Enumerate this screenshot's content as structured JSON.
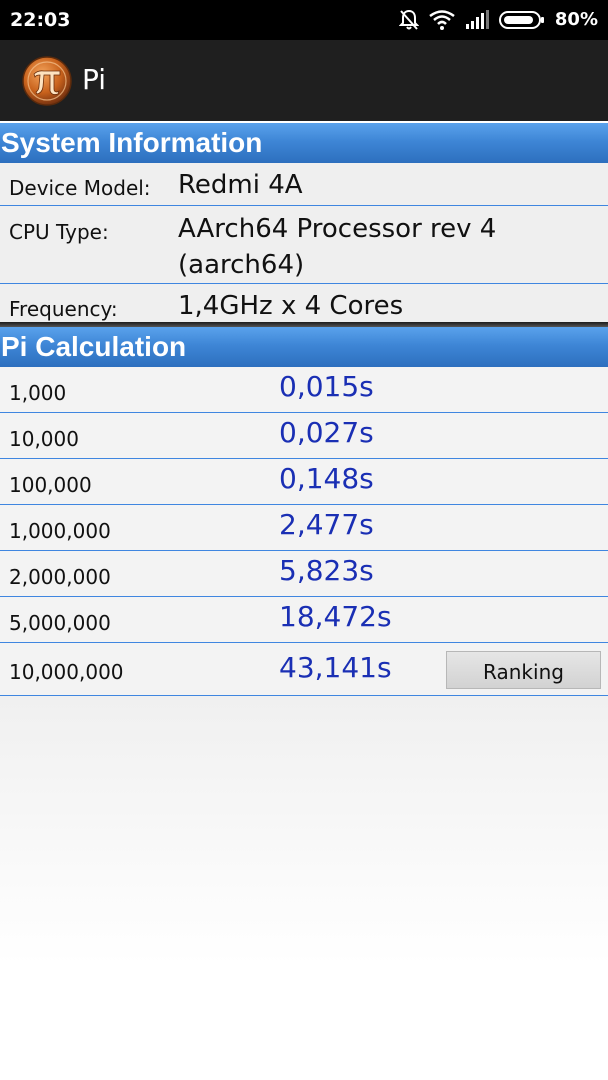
{
  "status_bar": {
    "time": "22:03",
    "battery_percent": "80%",
    "icons": [
      "notifications-off-icon",
      "wifi-icon",
      "signal-icon",
      "battery-icon"
    ]
  },
  "app_bar": {
    "title": "Pi",
    "icon": "pi-logo-icon"
  },
  "system_information": {
    "header": "System Information",
    "rows": [
      {
        "label": "Device Model:",
        "value": "Redmi 4A"
      },
      {
        "label": "CPU Type:",
        "value": "AArch64 Processor rev 4 (aarch64)"
      },
      {
        "label": "Frequency:",
        "value": "1,4GHz x 4 Cores"
      }
    ]
  },
  "pi_calculation": {
    "header": "Pi Calculation",
    "rows": [
      {
        "digits": "1,000",
        "time": "0,015s"
      },
      {
        "digits": "10,000",
        "time": "0,027s"
      },
      {
        "digits": "100,000",
        "time": "0,148s"
      },
      {
        "digits": "1,000,000",
        "time": "2,477s"
      },
      {
        "digits": "2,000,000",
        "time": "5,823s"
      },
      {
        "digits": "5,000,000",
        "time": "18,472s"
      },
      {
        "digits": "10,000,000",
        "time": "43,141s"
      }
    ],
    "ranking_label": "Ranking"
  },
  "colors": {
    "header_blue": "#3e86d6",
    "time_blue": "#1a2fb4",
    "divider_blue": "#3f86e0"
  }
}
